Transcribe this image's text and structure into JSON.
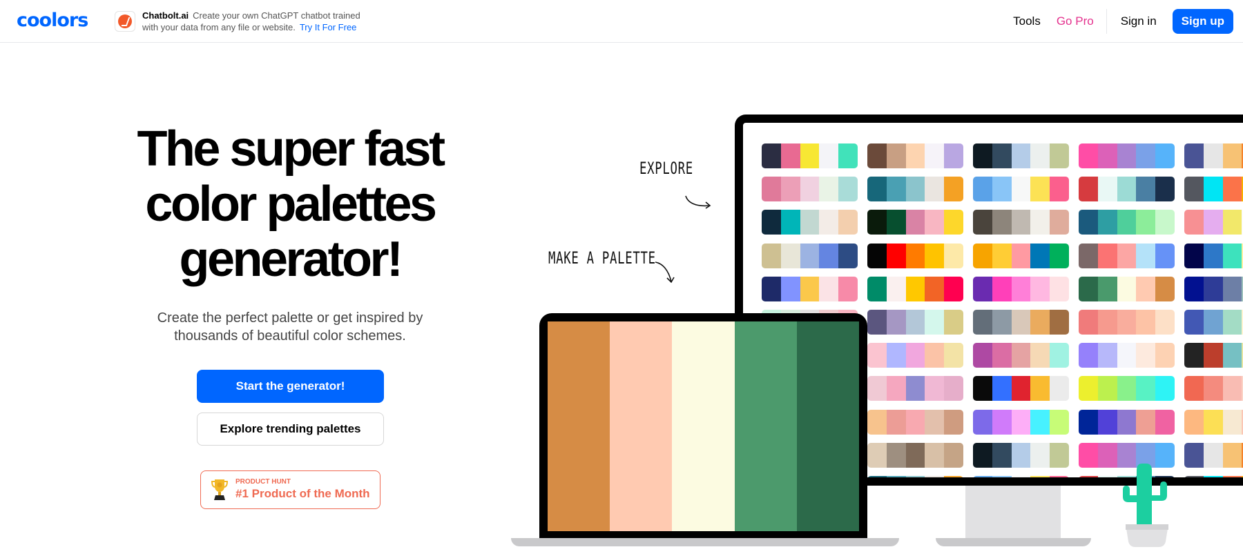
{
  "nav": {
    "logo": "coolors",
    "ad": {
      "brand": "Chatbolt.ai",
      "text": "Create your own ChatGPT chatbot trained with your data from any file or website.",
      "cta": "Try It For Free"
    },
    "tools": "Tools",
    "go_pro": "Go Pro",
    "sign_in": "Sign in",
    "sign_up": "Sign up"
  },
  "hero": {
    "title_line1": "The super fast",
    "title_line2": "color palettes",
    "title_line3": "generator!",
    "subtitle": "Create the perfect palette or get inspired by thousands of beautiful color schemes.",
    "primary_button": "Start the generator!",
    "secondary_button": "Explore trending palettes",
    "badge_small": "PRODUCT HUNT",
    "badge_big": "#1 Product of the Month"
  },
  "illustration": {
    "annotation_explore": "EXPLORE",
    "annotation_make": "MAKE A PALETTE",
    "laptop_palette": [
      "#d68c45",
      "#ffcab1",
      "#fcfbe1",
      "#4c9a6c",
      "#2c6a4a"
    ],
    "monitor_palettes": [
      [
        [
          "#2b2d42",
          "#e86a92",
          "#f7e733",
          "#f4f4f8",
          "#41e2ba"
        ],
        [
          "#6b4a3a",
          "#c89f83",
          "#fdd4b0",
          "#f6f3f9",
          "#b9a7e2"
        ],
        [
          "#0e1a22",
          "#324a5f",
          "#b4cce8",
          "#ecf0ee",
          "#c1c996"
        ],
        [
          "#ff4da6",
          "#dc61b8",
          "#a883d2",
          "#7aa1e8",
          "#56b3fa"
        ],
        [
          "#4a5495",
          "#e6e6e6",
          "#f7c274",
          "#f5842a",
          "#2b2b2b"
        ]
      ],
      [
        [
          "#e07a9a",
          "#ec9fb7",
          "#f0d1e0",
          "#e9f3e6",
          "#a9dcd8"
        ],
        [
          "#17677a",
          "#4aa0b3",
          "#8bc4cc",
          "#eae5e0",
          "#f4a124"
        ],
        [
          "#5aa2e8",
          "#89c5f7",
          "#f7f8f8",
          "#fce255",
          "#fb5f8d"
        ],
        [
          "#d63b3f",
          "#e9f8f5",
          "#9cdbd5",
          "#4a7fa3",
          "#1a2f4b"
        ],
        [
          "#54575f",
          "#00e5f4",
          "#fb7349",
          "#f9b000",
          "#3d3d3d"
        ]
      ],
      [
        [
          "#0f2a3d",
          "#00b5b8",
          "#c2d8d1",
          "#f3ece7",
          "#f3cfae"
        ],
        [
          "#0a1b0b",
          "#074f2f",
          "#d983a5",
          "#f8b6c2",
          "#fdd72b"
        ],
        [
          "#4a443c",
          "#8d857b",
          "#c0b9b1",
          "#f2f0ea",
          "#dfac9c"
        ],
        [
          "#1b5a7d",
          "#2e9ea3",
          "#4fcf9b",
          "#8ced9a",
          "#c8f8cb"
        ],
        [
          "#f79093",
          "#e5adef",
          "#f2e86a",
          "#fcfcfc",
          "#f7e7d4"
        ]
      ],
      [
        [
          "#cec092",
          "#e8e6d8",
          "#9cb3e2",
          "#6485e1",
          "#2d4c84"
        ],
        [
          "#050505",
          "#ff0000",
          "#ff7b00",
          "#ffc300",
          "#fde9a8"
        ],
        [
          "#f7a400",
          "#ffcd35",
          "#ff9aa2",
          "#0077b6",
          "#00b05b"
        ],
        [
          "#7b6868",
          "#fb7373",
          "#fca6a4",
          "#b4e2f9",
          "#6692f7"
        ],
        [
          "#02054a",
          "#2d78c8",
          "#3de2bd",
          "#fdf1a2",
          "#fe9f3f"
        ]
      ],
      [
        [
          "#1e2a68",
          "#8193ff",
          "#fbc84b",
          "#fbe3e6",
          "#f78aa8"
        ],
        [
          "#008b68",
          "#faf0ef",
          "#ffc800",
          "#f26426",
          "#ff0050"
        ],
        [
          "#6a2bb0",
          "#ff40b9",
          "#ff7fd8",
          "#ffb8e1",
          "#fee1e4"
        ],
        [
          "#2b6a4a",
          "#4a9a6c",
          "#fcfbe1",
          "#ffcab1",
          "#d68c45"
        ],
        [
          "#021190",
          "#2e3c97",
          "#6d7fa6",
          "#9ec2bd",
          "#f4eabd"
        ]
      ],
      [
        [
          "#c5f1dd",
          "#d7ecdc",
          "#e3e0e0",
          "#f0c9cc",
          "#f9b3c0"
        ],
        [
          "#5b567f",
          "#a597c3",
          "#b3c7d8",
          "#d4f7ec",
          "#d9cc87"
        ],
        [
          "#636e79",
          "#8d9aa5",
          "#d9c8b9",
          "#eaab5e",
          "#a06e42"
        ],
        [
          "#f07b7b",
          "#f69a8e",
          "#f9ad9d",
          "#fdc3a6",
          "#fde0c7"
        ],
        [
          "#4258b4",
          "#70a3d2",
          "#a3dcc5",
          "#fff4d1",
          "#ffa94e"
        ]
      ],
      [
        [
          "#f76b6b",
          "#e8999b",
          "#ceb3b8",
          "#b5d5d8",
          "#9df8f6"
        ],
        [
          "#fbc4d0",
          "#b0b7ff",
          "#f1a7de",
          "#fbc3a7",
          "#f3e3a6"
        ],
        [
          "#ae49a3",
          "#db6da4",
          "#e5a3a3",
          "#f6d9b5",
          "#a0f2e2"
        ],
        [
          "#9581fb",
          "#b7b8fa",
          "#f5f6fb",
          "#fdeade",
          "#fdd2b3"
        ],
        [
          "#232323",
          "#bc3e2c",
          "#76c0c3",
          "#e6e5a1",
          "#f7e3c7"
        ]
      ],
      [
        [
          "#a4d9ee",
          "#f9a825",
          "#fdd548",
          "#548b34",
          "#134a14"
        ],
        [
          "#f0c9d4",
          "#f5a7bf",
          "#8e8cd0",
          "#f0b8d4",
          "#e6aeca"
        ],
        [
          "#0a0a0a",
          "#3370ff",
          "#e0232f",
          "#f9bb30",
          "#ebebeb"
        ],
        [
          "#ecef2e",
          "#bcf04e",
          "#89f18b",
          "#58f2c4",
          "#2ef3f5"
        ],
        [
          "#f16852",
          "#f48b7e",
          "#f9bcb3",
          "#fbd4c7",
          "#fde9d9"
        ]
      ],
      [
        [
          "#0b1fc4",
          "#2c87f0",
          "#a6d1f4",
          "#fbf000",
          "#ffc400"
        ],
        [
          "#f7c38d",
          "#ec9d96",
          "#f8a9b0",
          "#e3c0ac",
          "#cf9c80"
        ],
        [
          "#7d6ae9",
          "#d07bfa",
          "#fdaef7",
          "#47f1ff",
          "#c7fc77"
        ],
        [
          "#002598",
          "#5141d8",
          "#8e78d0",
          "#ee9f94",
          "#f062a2"
        ],
        [
          "#fdb880",
          "#fcdf55",
          "#f7e9d2",
          "#fbc7b5",
          "#e4755b"
        ]
      ],
      [
        [
          "#6b4a3a",
          "#c89f83",
          "#fdd4b0",
          "#f6f3f9",
          "#b9a7e2"
        ],
        [
          "#deccb5",
          "#9e8f80",
          "#7f6a59",
          "#d8c0a7",
          "#c5a486"
        ],
        [
          "#0e1a22",
          "#324a5f",
          "#b4cce8",
          "#ecf0ee",
          "#c1c996"
        ],
        [
          "#ff4da6",
          "#dc61b8",
          "#a883d2",
          "#7aa1e8",
          "#56b3fa"
        ],
        [
          "#4a5495",
          "#e6e6e6",
          "#f7c274",
          "#f5842a",
          "#2b2b2b"
        ]
      ],
      [
        [
          "#17677a",
          "#4aa0b3",
          "#8bc4cc",
          "#eae5e0",
          "#f4a124"
        ],
        [
          "#17677a",
          "#4aa0b3",
          "#8bc4cc",
          "#eae5e0",
          "#f4a124"
        ],
        [
          "#5aa2e8",
          "#89c5f7",
          "#f7f8f8",
          "#fce255",
          "#fb5f8d"
        ],
        [
          "#d63b3f",
          "#e9f8f5",
          "#9cdbd5",
          "#4a7fa3",
          "#1a2f4b"
        ],
        [
          "#54575f",
          "#00e5f4",
          "#fb7349",
          "#f9b000",
          "#3d3d3d"
        ]
      ]
    ]
  }
}
